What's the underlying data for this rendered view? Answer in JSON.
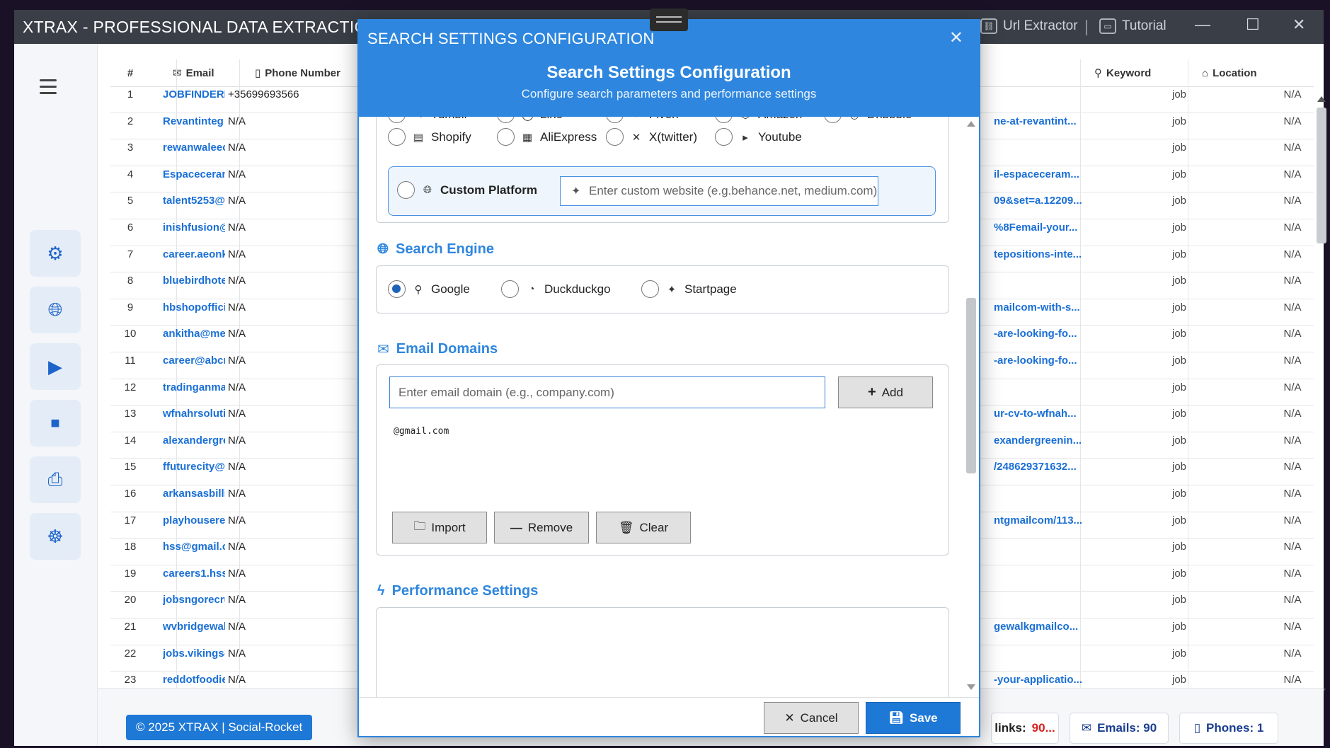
{
  "app": {
    "title": "XTRAX - PROFESSIONAL DATA EXTRACTION TOOL",
    "toolbar": {
      "url_extractor": "Url Extractor",
      "tutorial": "Tutorial"
    }
  },
  "table": {
    "headers": {
      "num": "#",
      "email": "Email",
      "phone": "Phone Number",
      "keyword": "Keyword",
      "location": "Location"
    },
    "rows": [
      {
        "n": "1",
        "email": "JOBFINDERM",
        "phone": "+35699693566",
        "link": "",
        "kw": "job",
        "loc": "N/A"
      },
      {
        "n": "2",
        "email": "Revantinteg",
        "phone": "N/A",
        "link": "ne-at-revantint...",
        "kw": "job",
        "loc": "N/A"
      },
      {
        "n": "3",
        "email": "rewanwaleec",
        "phone": "N/A",
        "link": "",
        "kw": "job",
        "loc": "N/A"
      },
      {
        "n": "4",
        "email": "Espaceceram",
        "phone": "N/A",
        "link": "il-espaceceram...",
        "kw": "job",
        "loc": "N/A"
      },
      {
        "n": "5",
        "email": "talent5253@",
        "phone": "N/A",
        "link": "09&set=a.12209...",
        "kw": "job",
        "loc": "N/A"
      },
      {
        "n": "6",
        "email": "inishfusion@",
        "phone": "N/A",
        "link": "%8Femail-your...",
        "kw": "job",
        "loc": "N/A"
      },
      {
        "n": "7",
        "email": "career.aeonk",
        "phone": "N/A",
        "link": "tepositions-inte...",
        "kw": "job",
        "loc": "N/A"
      },
      {
        "n": "8",
        "email": "bluebirdhote",
        "phone": "N/A",
        "link": "",
        "kw": "job",
        "loc": "N/A"
      },
      {
        "n": "9",
        "email": "hbshopoffici",
        "phone": "N/A",
        "link": "mailcom-with-s...",
        "kw": "job",
        "loc": "N/A"
      },
      {
        "n": "10",
        "email": "ankitha@me",
        "phone": "N/A",
        "link": "-are-looking-fo...",
        "kw": "job",
        "loc": "N/A"
      },
      {
        "n": "11",
        "email": "career@abcr",
        "phone": "N/A",
        "link": "-are-looking-fo...",
        "kw": "job",
        "loc": "N/A"
      },
      {
        "n": "12",
        "email": "tradinganma",
        "phone": "N/A",
        "link": "",
        "kw": "job",
        "loc": "N/A"
      },
      {
        "n": "13",
        "email": "wfnahrsoluti",
        "phone": "N/A",
        "link": "ur-cv-to-wfnah...",
        "kw": "job",
        "loc": "N/A"
      },
      {
        "n": "14",
        "email": "alexandergre",
        "phone": "N/A",
        "link": "exandergreenin...",
        "kw": "job",
        "loc": "N/A"
      },
      {
        "n": "15",
        "email": "ffuturecity@",
        "phone": "N/A",
        "link": "/248629371632...",
        "kw": "job",
        "loc": "N/A"
      },
      {
        "n": "16",
        "email": "arkansasbilli",
        "phone": "N/A",
        "link": "",
        "kw": "job",
        "loc": "N/A"
      },
      {
        "n": "17",
        "email": "playhousere",
        "phone": "N/A",
        "link": "ntgmailcom/113...",
        "kw": "job",
        "loc": "N/A"
      },
      {
        "n": "18",
        "email": "hss@gmail.c",
        "phone": "N/A",
        "link": "",
        "kw": "job",
        "loc": "N/A"
      },
      {
        "n": "19",
        "email": "careers1.hss@",
        "phone": "N/A",
        "link": "",
        "kw": "job",
        "loc": "N/A"
      },
      {
        "n": "20",
        "email": "jobsngorecru",
        "phone": "N/A",
        "link": "",
        "kw": "job",
        "loc": "N/A"
      },
      {
        "n": "21",
        "email": "wvbridgewal",
        "phone": "N/A",
        "link": "gewalkgmailco...",
        "kw": "job",
        "loc": "N/A"
      },
      {
        "n": "22",
        "email": "jobs.vikings@",
        "phone": "N/A",
        "link": "",
        "kw": "job",
        "loc": "N/A"
      },
      {
        "n": "23",
        "email": "reddotfoodie",
        "phone": "N/A",
        "link": "-your-applicatio...",
        "kw": "job",
        "loc": "N/A"
      }
    ]
  },
  "footer": {
    "copyright": "© 2025 XTRAX | Social-Rocket",
    "links_label": "links:",
    "links_value": "90...",
    "emails": "Emails: 90",
    "phones": "Phones: 1"
  },
  "dialog": {
    "window_title": "SEARCH SETTINGS CONFIGURATION",
    "heading": "Search Settings Configuration",
    "subheading": "Configure search parameters and performance settings",
    "platforms": [
      {
        "label": "Tumblr",
        "icon": "✎"
      },
      {
        "label": "Line",
        "icon": "◯"
      },
      {
        "label": "Fiverr",
        "icon": "♥"
      },
      {
        "label": "Amazon",
        "icon": "⬡"
      },
      {
        "label": "Dribbble",
        "icon": "◎"
      },
      {
        "label": "Shopify",
        "icon": "▤"
      },
      {
        "label": "AliExpress",
        "icon": "▦"
      },
      {
        "label": "X(twitter)",
        "icon": "✕"
      },
      {
        "label": "Youtube",
        "icon": "▸"
      }
    ],
    "custom_platform_label": "Custom Platform",
    "custom_platform_placeholder": "Enter custom website (e.g.behance.net, medium.com)",
    "search_engine_title": "Search Engine",
    "engines": [
      {
        "label": "Google",
        "selected": true
      },
      {
        "label": "Duckduckgo",
        "selected": false
      },
      {
        "label": "Startpage",
        "selected": false
      }
    ],
    "email_domains_title": "Email Domains",
    "domain_placeholder": "Enter email domain (e.g., company.com)",
    "add_label": "Add",
    "domains": [
      "@gmail.com"
    ],
    "import_label": "Import",
    "remove_label": "Remove",
    "clear_label": "Clear",
    "performance_title": "Performance Settings",
    "cancel_label": "Cancel",
    "save_label": "Save"
  }
}
